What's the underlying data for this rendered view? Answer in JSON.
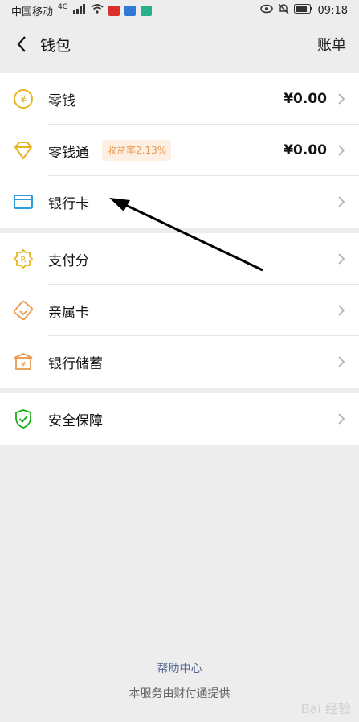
{
  "status_bar": {
    "carrier": "中国移动",
    "network": "4G",
    "time": "09:18"
  },
  "header": {
    "title": "钱包",
    "right_action": "账单"
  },
  "sections": {
    "wallet": {
      "items": [
        {
          "label": "零钱",
          "value": "¥0.00",
          "icon": "coin-icon"
        },
        {
          "label": "零钱通",
          "badge": "收益率2.13%",
          "value": "¥0.00",
          "icon": "diamond-icon"
        },
        {
          "label": "银行卡",
          "icon": "bank-card-icon"
        }
      ]
    },
    "services": {
      "items": [
        {
          "label": "支付分",
          "icon": "pay-score-icon"
        },
        {
          "label": "亲属卡",
          "icon": "family-card-icon"
        },
        {
          "label": "银行储蓄",
          "icon": "bank-savings-icon"
        }
      ]
    },
    "security": {
      "items": [
        {
          "label": "安全保障",
          "icon": "shield-check-icon"
        }
      ]
    }
  },
  "footer": {
    "help_link": "帮助中心",
    "provider_note": "本服务由财付通提供"
  },
  "watermark": "Bai 经验",
  "colors": {
    "background": "#ededed",
    "gold_icon": "#e7b523",
    "green_icon": "#1aad19",
    "blue_icon": "#2f9bd9",
    "link": "#576b95"
  }
}
